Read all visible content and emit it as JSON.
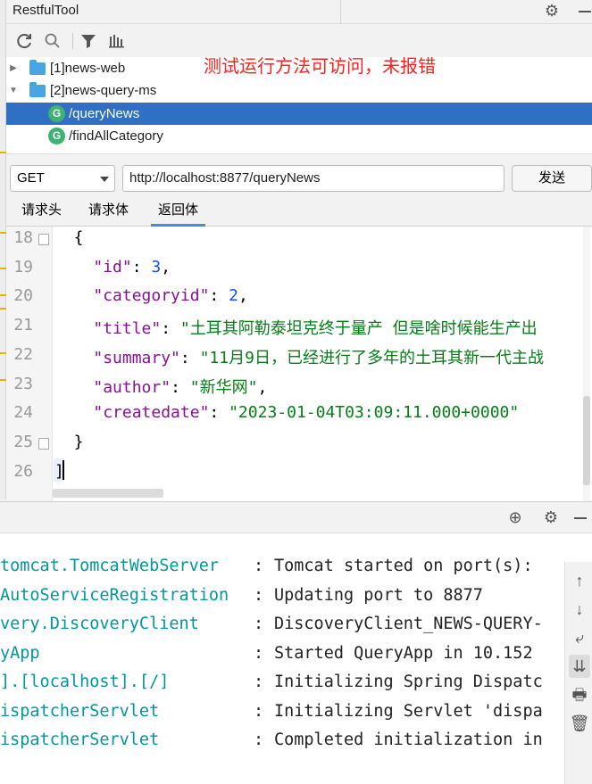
{
  "window": {
    "title": "RestfulTool"
  },
  "annotation": "测试运行方法可访问，未报错",
  "tree": {
    "projects": [
      {
        "label": "[1]news-web",
        "expanded": false
      },
      {
        "label": "[2]news-query-ms",
        "expanded": true
      }
    ],
    "endpoints": [
      {
        "icon_letter": "G",
        "label": "/queryNews",
        "selected": true
      },
      {
        "icon_letter": "G",
        "label": "/findAllCategory",
        "selected": false
      }
    ]
  },
  "request": {
    "method": "GET",
    "url": "http://localhost:8877/queryNews",
    "send_label": "发送"
  },
  "tabs": [
    {
      "label": "请求头",
      "active": false
    },
    {
      "label": "请求体",
      "active": false
    },
    {
      "label": "返回体",
      "active": true
    }
  ],
  "editor": {
    "lines": [
      {
        "num": "18",
        "pre": "  {",
        "key": "",
        "mid": "",
        "val": "",
        "post": ""
      },
      {
        "num": "19",
        "pre": "    ",
        "key": "\"id\"",
        "mid": ": ",
        "val": "3",
        "post": ","
      },
      {
        "num": "20",
        "pre": "    ",
        "key": "\"categoryid\"",
        "mid": ": ",
        "val": "2",
        "post": ","
      },
      {
        "num": "21",
        "pre": "    ",
        "key": "\"title\"",
        "mid": ": ",
        "val": "\"土耳其阿勒泰坦克终于量产 但是啥时候能生产出",
        "post": ""
      },
      {
        "num": "22",
        "pre": "    ",
        "key": "\"summary\"",
        "mid": ": ",
        "val": "\"11月9日，已经进行了多年的土耳其新一代主战",
        "post": ""
      },
      {
        "num": "23",
        "pre": "    ",
        "key": "\"author\"",
        "mid": ": ",
        "val": "\"新华网\"",
        "post": ","
      },
      {
        "num": "24",
        "pre": "    ",
        "key": "\"createdate\"",
        "mid": ": ",
        "val": "\"2023-01-04T03:09:11.000+0000\"",
        "post": ""
      },
      {
        "num": "25",
        "pre": "  }",
        "key": "",
        "mid": "",
        "val": "",
        "post": ""
      },
      {
        "num": "26",
        "pre": "]",
        "key": "",
        "mid": "",
        "val": "",
        "post": ""
      }
    ]
  },
  "console": {
    "lines": [
      {
        "src": "o.s.b.w.embedded.tomcat.TomcatWebServer",
        "msg": "Tomcat started on port(s): "
      },
      {
        "src": "o.s.c.n.e.s.EurekaAutoServiceRegistration",
        "msg": "Updating port to 8877"
      },
      {
        "src": "com.netflix.discovery.DiscoveryClient",
        "msg": "DiscoveryClient_NEWS-QUERY-"
      },
      {
        "src": "com.qf.QueryApp",
        "msg": "Started QueryApp in 10.152 "
      },
      {
        "src": "o.a.c.c.C.[Tomcat].[localhost].[/]",
        "msg": "Initializing Spring Dispatc"
      },
      {
        "src": "o.s.web.servlet.DispatcherServlet",
        "msg": "Initializing Servlet 'dispa"
      },
      {
        "src": "o.s.web.servlet.DispatcherServlet",
        "msg": "Completed initialization in"
      }
    ],
    "visible_src": [
      "tomcat.TomcatWebServer",
      "AutoServiceRegistration",
      "very.DiscoveryClient",
      "yApp",
      "].[localhost].[/]",
      "ispatcherServlet",
      "ispatcherServlet"
    ]
  },
  "icons": {
    "refresh": "refresh-icon",
    "search": "search-icon",
    "filter": "filter-icon",
    "chart": "bars-icon",
    "settings": "gear-icon",
    "target": "crosshair-icon"
  },
  "colors": {
    "selection": "#2f6fc4",
    "annotation": "#ff2020",
    "json_key": "#871094",
    "json_number": "#1750eb",
    "json_string": "#067d17",
    "console_source": "#00979d"
  }
}
